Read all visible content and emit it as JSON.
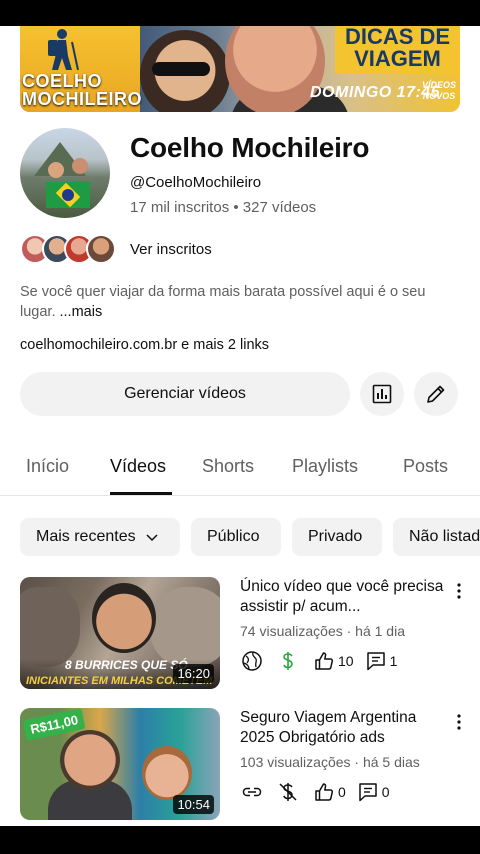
{
  "banner": {
    "brand_line1": "COELHO",
    "brand_line2": "MOCHILEIRO",
    "dicas_line1": "DICAS DE",
    "dicas_line2": "VIAGEM",
    "schedule": "DOMINGO 17:45",
    "novos_line1": "VÍDEOS",
    "novos_line2": "NOVOS"
  },
  "channel": {
    "title": "Coelho Mochileiro",
    "handle": "@CoelhoMochileiro",
    "stats": "17 mil inscritos • 327 vídeos",
    "subscribers_link": "Ver inscritos",
    "description": "Se você quer viajar da forma mais barata possível aqui é o seu lugar. ",
    "description_more": "...mais",
    "links": "coelhomochileiro.com.br e mais 2 links"
  },
  "actions": {
    "manage_label": "Gerenciar vídeos",
    "analytics_icon": "analytics-icon",
    "edit_icon": "pencil-icon"
  },
  "tabs": [
    "Início",
    "Vídeos",
    "Shorts",
    "Playlists",
    "Posts"
  ],
  "active_tab": "Vídeos",
  "chips": {
    "sort": "Mais recentes",
    "public": "Público",
    "private": "Privado",
    "unlisted": "Não listad"
  },
  "videos": [
    {
      "title": "Único vídeo que você precisa assistir p/ acum...",
      "thumb_caption1": "8 BURRICES QUE SÓ",
      "thumb_caption2": "INICIANTES EM MILHAS COMETEM",
      "duration": "16:20",
      "meta": "74 visualizações · há 1 dia",
      "visibility_icon": "globe-icon",
      "monetization_icon": "dollar-icon",
      "likes": "10",
      "comments": "1"
    },
    {
      "title": "Seguro Viagem Argentina 2025 Obrigatório ads",
      "thumb_badge": "R$11,00",
      "duration": "10:54",
      "meta": "103 visualizações · há 5 dias",
      "visibility_icon": "link-icon",
      "monetization_icon": "dollar-off-icon",
      "likes": "0",
      "comments": "0"
    }
  ]
}
